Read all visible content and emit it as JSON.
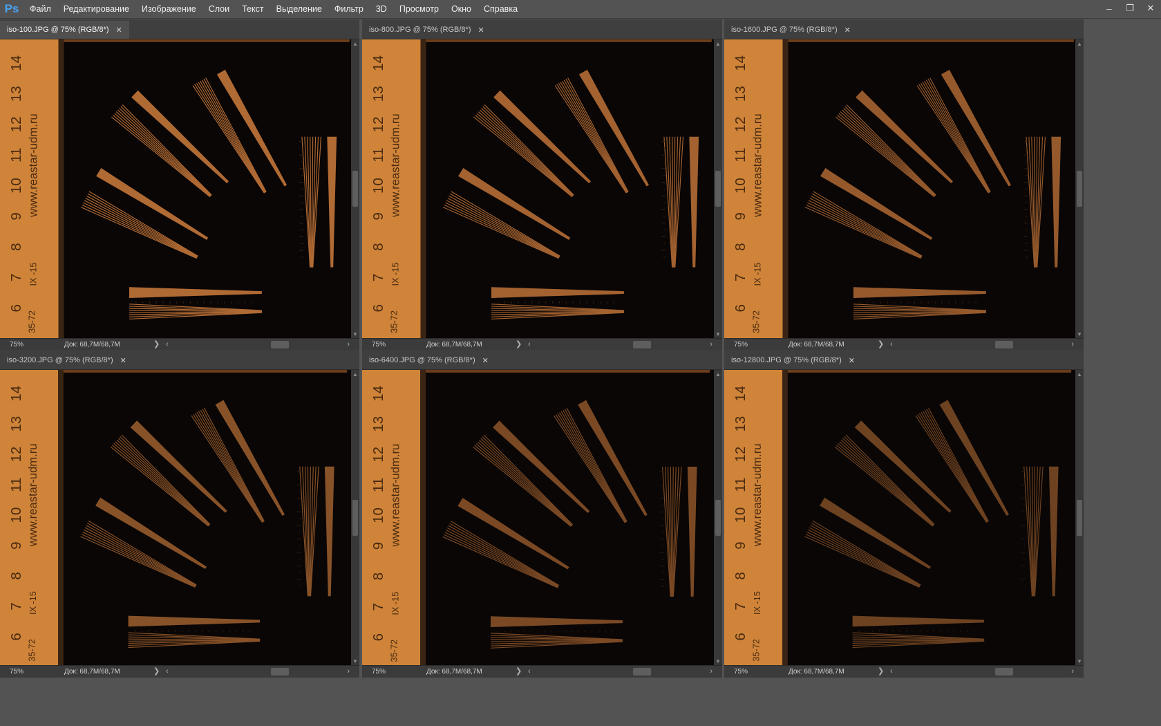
{
  "app": {
    "logo": "Ps"
  },
  "menu": [
    "Файл",
    "Редактирование",
    "Изображение",
    "Слои",
    "Текст",
    "Выделение",
    "Фильтр",
    "3D",
    "Просмотр",
    "Окно",
    "Справка"
  ],
  "window_controls": {
    "minimize": "–",
    "restore": "❐",
    "close": "✕"
  },
  "documents": [
    {
      "tab": "iso-100.JPG @ 75% (RGB/8*)",
      "zoom": "75%",
      "doc_size": "Док: 68,7M/68,7M",
      "active": true
    },
    {
      "tab": "iso-800.JPG @ 75% (RGB/8*)",
      "zoom": "75%",
      "doc_size": "Док: 68,7M/68,7M",
      "active": false
    },
    {
      "tab": "iso-1600.JPG @ 75% (RGB/8*)",
      "zoom": "75%",
      "doc_size": "Док: 68,7M/68,7M",
      "active": false
    },
    {
      "tab": "iso-3200.JPG @ 75% (RGB/8*)",
      "zoom": "75%",
      "doc_size": "Док: 68,7M/68,7M",
      "active": false
    },
    {
      "tab": "iso-6400.JPG @ 75% (RGB/8*)",
      "zoom": "75%",
      "doc_size": "Док: 68,7M/68,7M",
      "active": false
    },
    {
      "tab": "iso-12800.JPG @ 75% (RGB/8*)",
      "zoom": "75%",
      "doc_size": "Док: 68,7M/68,7M",
      "active": false
    }
  ],
  "ruler": {
    "numbers": [
      "14",
      "13",
      "12",
      "11",
      "10",
      "9",
      "8",
      "7",
      "6"
    ],
    "url": "www.reastar-udm.ru",
    "code": "IX -15",
    "model": "35-72"
  },
  "colors": {
    "ruler": "#cf8439",
    "pattern": "#b06a34",
    "canvas": "#0a0605"
  }
}
